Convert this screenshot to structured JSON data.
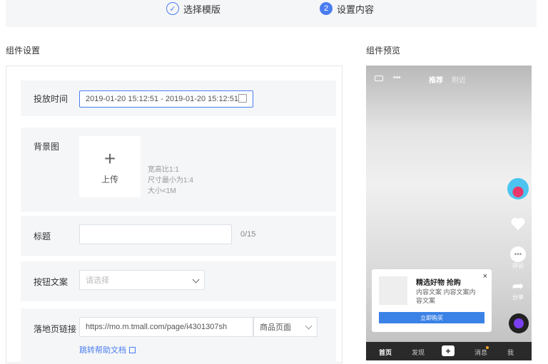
{
  "steps": {
    "step1_label": "选择模版",
    "step1_icon": "check-icon",
    "step2_label": "设置内容",
    "step2_number": "2"
  },
  "sections": {
    "settings_title": "组件设置",
    "preview_title": "组件预览"
  },
  "form": {
    "time": {
      "label": "投放时间",
      "start": "2019-01-20 15:12:51",
      "separator": "-",
      "end": "2019-01-20 15:12:51"
    },
    "image": {
      "label": "背景图",
      "upload_label": "上传",
      "hints": [
        "宽高比1:1",
        "尺寸最小为1:4",
        "大小<1M"
      ]
    },
    "title": {
      "label": "标题",
      "value": "",
      "counter": "0/15"
    },
    "button_text": {
      "label": "按钮文案",
      "placeholder": "请选择"
    },
    "landing_link": {
      "label": "落地页链接",
      "value": "https://mo.m.tmall.com/page/i4301307sh",
      "type": "商品页面",
      "help": "跳转帮助文档"
    }
  },
  "preview": {
    "top_bar": {
      "dots": "•••",
      "follow": "推荐",
      "recommend": "附近"
    },
    "side": {
      "like_count": "",
      "comment_count": "评论",
      "share_count": "分享"
    },
    "card": {
      "title": "精选好物 抢购",
      "description": "内容文案 内容文案内容文案",
      "close": "×",
      "button": "立即购买"
    },
    "nav": {
      "home": "首页",
      "discover": "发现",
      "add": "+",
      "messages": "消息",
      "me": "我"
    }
  }
}
